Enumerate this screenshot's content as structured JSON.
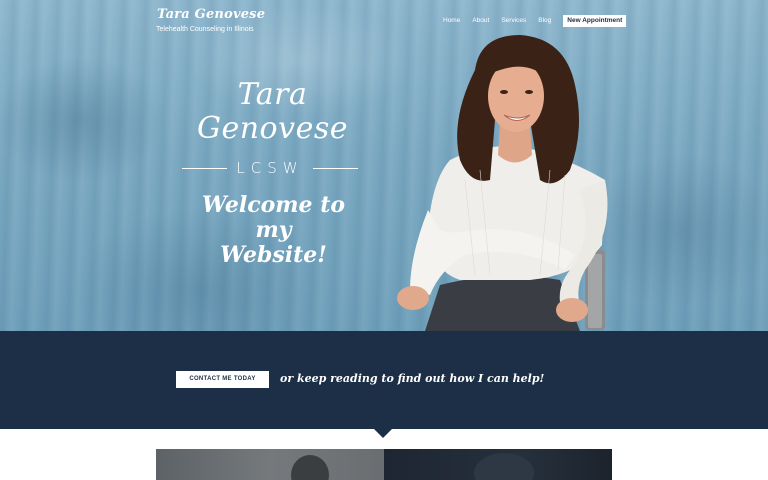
{
  "site": {
    "logo_title": "Tara Genovese",
    "logo_subtitle": "Telehealth Counseling in Illinois"
  },
  "nav": {
    "items": [
      "Home",
      "About",
      "Services",
      "Blog"
    ],
    "cta": "New Appointment"
  },
  "hero": {
    "name_line1": "Tara",
    "name_line2": "Genovese",
    "credential": "LCSW",
    "welcome_line1": "Welcome to my",
    "welcome_line2": "Website!"
  },
  "band": {
    "button_label": "CONTACT ME TODAY",
    "text": "or keep reading to find out how I can help!"
  },
  "colors": {
    "hero_blue": "#7ba9c2",
    "navy": "#1c2f47",
    "white": "#ffffff"
  }
}
